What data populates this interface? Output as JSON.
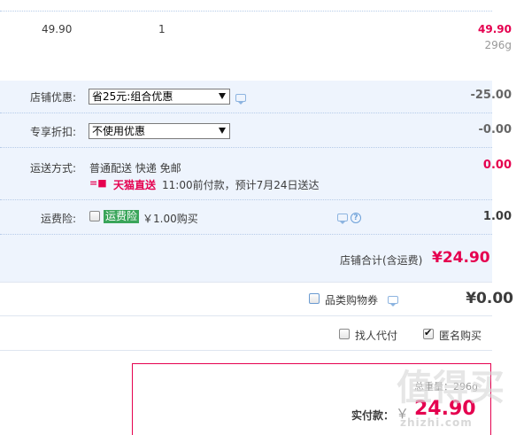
{
  "item": {
    "unit_price": "49.90",
    "quantity": "1",
    "subtotal": "49.90",
    "weight": "296g"
  },
  "shop_discount": {
    "label": "店铺优惠:",
    "selected": "省25元:组合优惠",
    "value": "-25.00"
  },
  "exclusive_discount": {
    "label": "专享折扣:",
    "selected": "不使用优惠",
    "value": "-0.00"
  },
  "shipping": {
    "label": "运送方式:",
    "method": "普通配送 快递 免邮",
    "tmall_direct": "天猫直送",
    "tmall_direct_mark": "=■",
    "delivery_note": "11:00前付款，预计7月24日送达",
    "value": "0.00"
  },
  "insurance": {
    "label": "运费险:",
    "badge": "运费险",
    "price_text": "￥1.00购买",
    "value": "1.00"
  },
  "shop_total": {
    "label": "店铺合计(含运费)",
    "value": "¥24.90"
  },
  "coupon": {
    "label": "品类购物券",
    "value": "¥0.00"
  },
  "options": {
    "proxy_pay_label": "找人代付",
    "anonymous_label": "匿名购买",
    "anonymous_checked": true
  },
  "payment": {
    "weight_text": "总重量：296g",
    "label": "实付款：",
    "currency": "￥",
    "amount": "24.90"
  },
  "watermark": {
    "text": "值得买",
    "url": "zhizhi.com"
  },
  "colors": {
    "accent_red": "#e5004f",
    "row_blue": "#eef4fd",
    "badge_green": "#3aa55a"
  }
}
